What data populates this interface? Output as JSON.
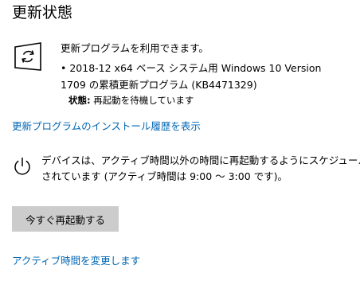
{
  "title": "更新状態",
  "update": {
    "icon": "refresh-icon",
    "available_text": "更新プログラムを利用できます。",
    "item_line1": "• 2018-12 x64 ベース システム用 Windows 10 Version",
    "item_line2": "1709 の累積更新プログラム (KB4471329)",
    "status_key": "状態:",
    "status_value": " 再起動を待機しています"
  },
  "history_link": "更新プログラムのインストール履歴を表示",
  "restart": {
    "icon": "power-icon",
    "line1": "デバイスは、アクティブ時間以外の時間に再起動するようにスケジュール",
    "line2": "されています (アクティブ時間は 9:00 〜 3:00 です)。"
  },
  "restart_button": "今すぐ再起動する",
  "active_hours_link": "アクティブ時間を変更します",
  "colors": {
    "link": "#0066b4",
    "button_bg": "#cccccc"
  }
}
